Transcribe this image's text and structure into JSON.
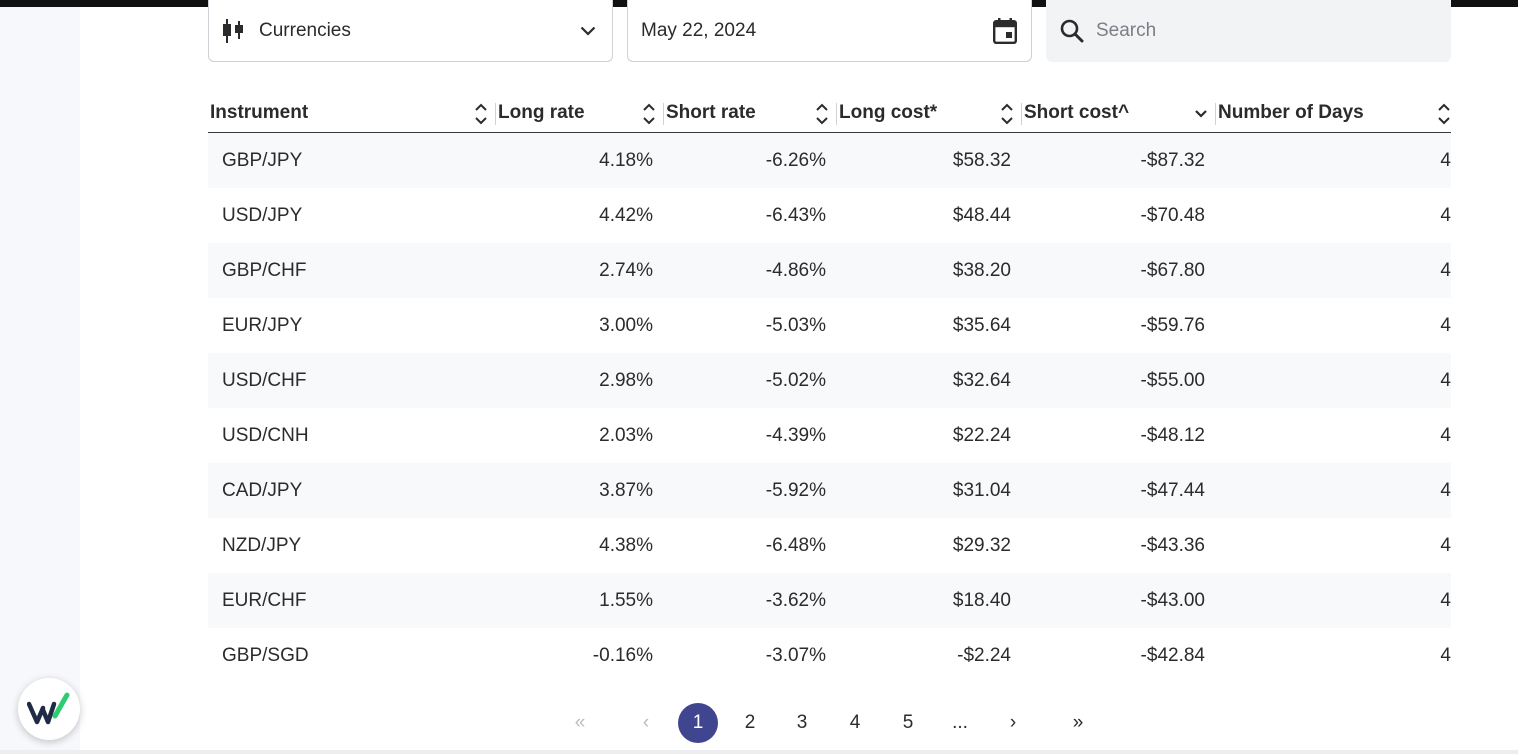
{
  "filters": {
    "category": {
      "value": "Currencies",
      "icon": "candlestick-icon"
    },
    "date": {
      "value": "May 22, 2024",
      "icon": "calendar-icon"
    },
    "search": {
      "placeholder": "Search",
      "icon": "search-icon"
    }
  },
  "table": {
    "columns": [
      {
        "label": "Instrument",
        "sort": "unsorted"
      },
      {
        "label": "Long rate",
        "sort": "unsorted"
      },
      {
        "label": "Short rate",
        "sort": "unsorted"
      },
      {
        "label": "Long cost*",
        "sort": "unsorted"
      },
      {
        "label": "Short cost^",
        "sort": "descending"
      },
      {
        "label": "Number of Days",
        "sort": "unsorted"
      }
    ],
    "rows": [
      [
        "GBP/JPY",
        "4.18%",
        "-6.26%",
        "$58.32",
        "-$87.32",
        "4"
      ],
      [
        "USD/JPY",
        "4.42%",
        "-6.43%",
        "$48.44",
        "-$70.48",
        "4"
      ],
      [
        "GBP/CHF",
        "2.74%",
        "-4.86%",
        "$38.20",
        "-$67.80",
        "4"
      ],
      [
        "EUR/JPY",
        "3.00%",
        "-5.03%",
        "$35.64",
        "-$59.76",
        "4"
      ],
      [
        "USD/CHF",
        "2.98%",
        "-5.02%",
        "$32.64",
        "-$55.00",
        "4"
      ],
      [
        "USD/CNH",
        "2.03%",
        "-4.39%",
        "$22.24",
        "-$48.12",
        "4"
      ],
      [
        "CAD/JPY",
        "3.87%",
        "-5.92%",
        "$31.04",
        "-$47.44",
        "4"
      ],
      [
        "NZD/JPY",
        "4.38%",
        "-6.48%",
        "$29.32",
        "-$43.36",
        "4"
      ],
      [
        "EUR/CHF",
        "1.55%",
        "-3.62%",
        "$18.40",
        "-$43.00",
        "4"
      ],
      [
        "GBP/SGD",
        "-0.16%",
        "-3.07%",
        "-$2.24",
        "-$42.84",
        "4"
      ]
    ]
  },
  "pagination": {
    "first": "«",
    "prev": "‹",
    "pages": [
      "1",
      "2",
      "3",
      "4",
      "5"
    ],
    "current": "1",
    "ellipsis": "...",
    "next": "›",
    "last": "»"
  },
  "colors": {
    "accent": "#3f458f",
    "logo_dark": "#1f2a44",
    "logo_green": "#2ecc71"
  }
}
